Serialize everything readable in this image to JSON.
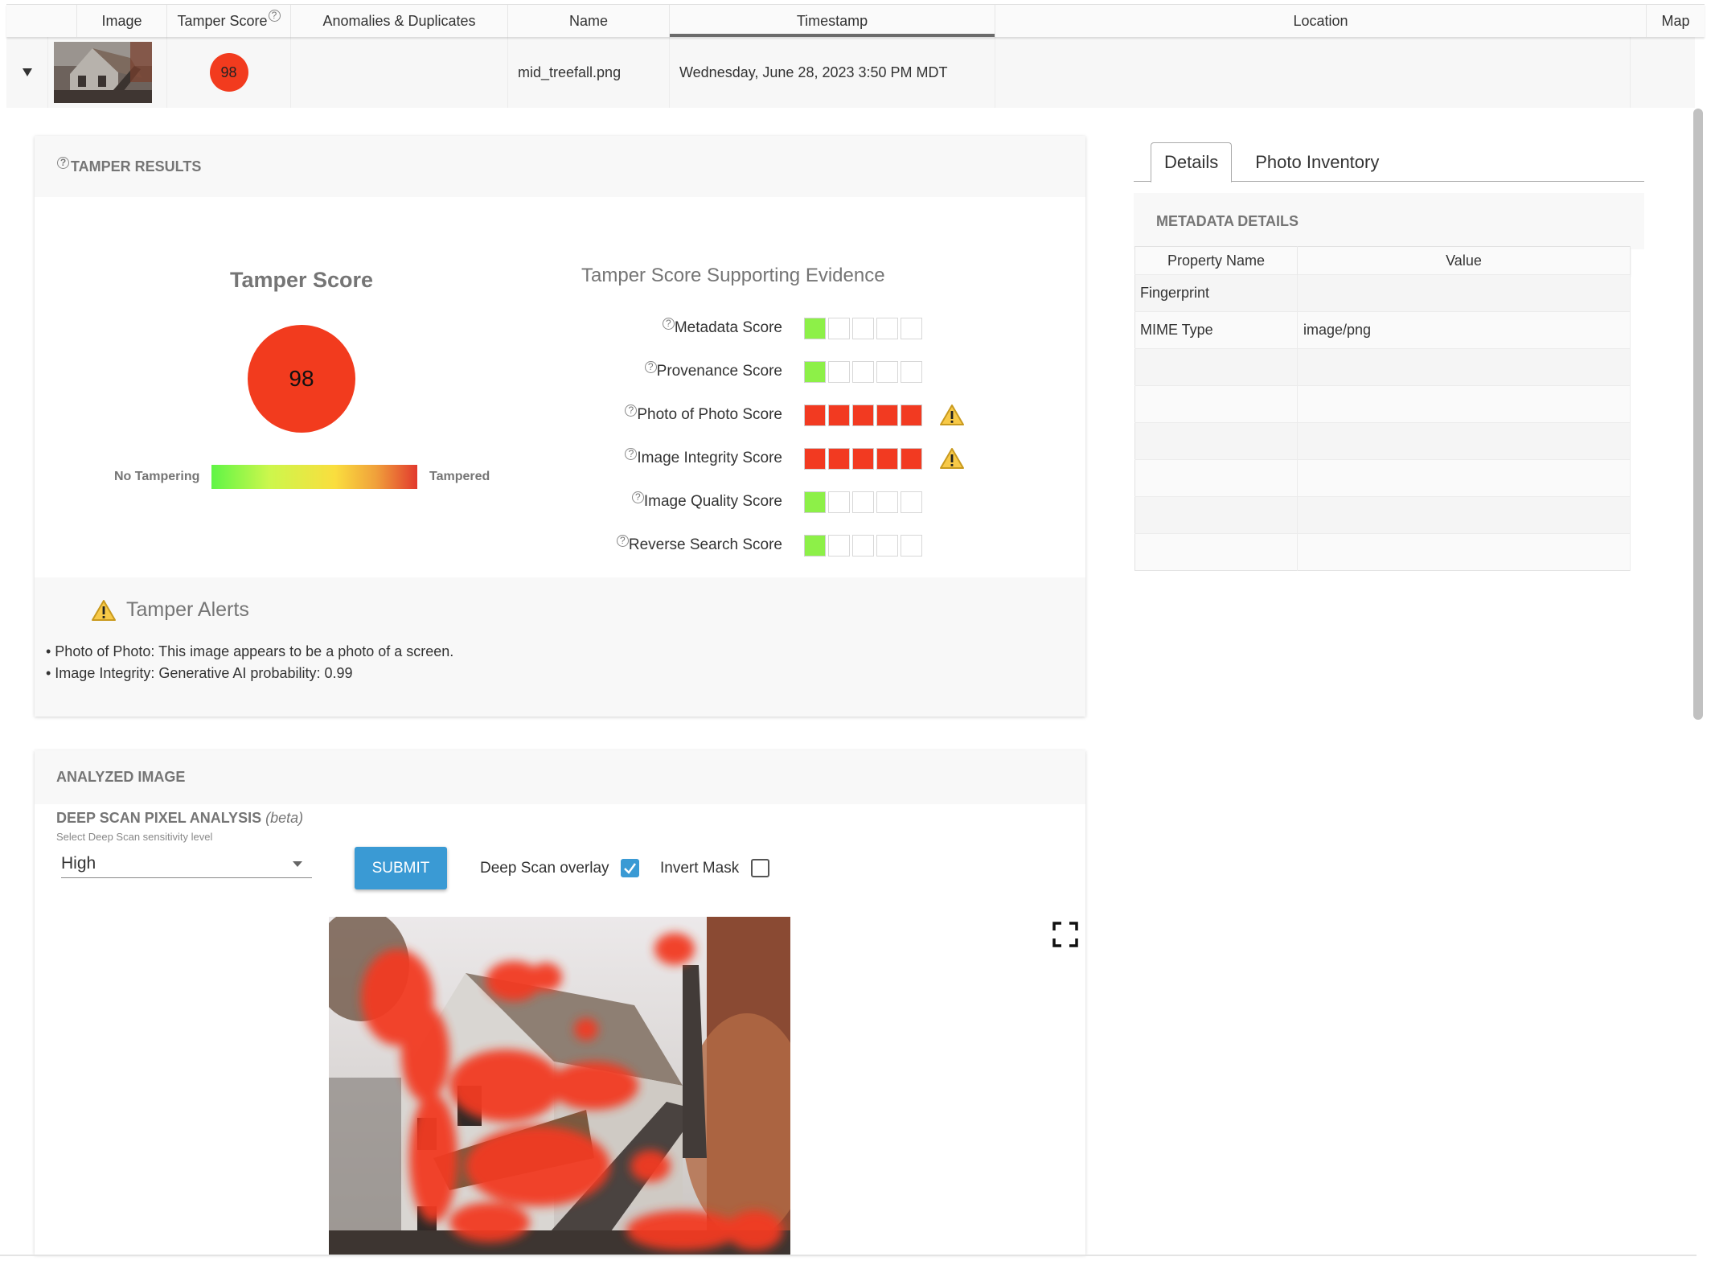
{
  "grid": {
    "columns": [
      {
        "key": "expand",
        "label": ""
      },
      {
        "key": "image",
        "label": "Image"
      },
      {
        "key": "tamper_score",
        "label": "Tamper Score",
        "help_icon": "question-circle-icon"
      },
      {
        "key": "anomalies",
        "label": "Anomalies & Duplicates"
      },
      {
        "key": "name",
        "label": "Name"
      },
      {
        "key": "timestamp",
        "label": "Timestamp",
        "sorted": true
      },
      {
        "key": "location",
        "label": "Location"
      },
      {
        "key": "map",
        "label": "Map"
      }
    ],
    "row": {
      "expanded": true,
      "tamper_score": "98",
      "anomalies": "",
      "name": "mid_treefall.png",
      "timestamp": "Wednesday, June 28, 2023 3:50 PM MDT",
      "location": "",
      "map": ""
    }
  },
  "tamper_results": {
    "section_title": "TAMPER RESULTS",
    "score_title": "Tamper Score",
    "score_value": "98",
    "score_color": "#f23b1e",
    "scale_low_label": "No Tampering",
    "scale_high_label": "Tampered",
    "evidence_title": "Tamper Score Supporting Evidence",
    "evidence": [
      {
        "label": "Metadata Score",
        "level": 1,
        "max": 5,
        "status": "ok",
        "warning": false
      },
      {
        "label": "Provenance Score",
        "level": 1,
        "max": 5,
        "status": "ok",
        "warning": false
      },
      {
        "label": "Photo of Photo Score",
        "level": 5,
        "max": 5,
        "status": "bad",
        "warning": true
      },
      {
        "label": "Image Integrity Score",
        "level": 5,
        "max": 5,
        "status": "bad",
        "warning": true
      },
      {
        "label": "Image Quality Score",
        "level": 1,
        "max": 5,
        "status": "ok",
        "warning": false
      },
      {
        "label": "Reverse Search Score",
        "level": 1,
        "max": 5,
        "status": "ok",
        "warning": false
      }
    ],
    "colors": {
      "ok": "#8df048",
      "bad": "#f23a21",
      "warning": "#f7c948"
    }
  },
  "tamper_alerts": {
    "title": "Tamper Alerts",
    "items": [
      "• Photo of Photo: This image appears to be a photo of a screen.",
      "• Image Integrity: Generative AI probability: 0.99"
    ]
  },
  "details_panel": {
    "tabs": [
      {
        "label": "Details",
        "active": true
      },
      {
        "label": "Photo Inventory",
        "active": false
      }
    ],
    "section_title": "METADATA DETAILS",
    "table": {
      "headers": [
        "Property Name",
        "Value"
      ],
      "rows": [
        [
          "Fingerprint",
          ""
        ],
        [
          "MIME Type",
          "image/png"
        ],
        [
          "",
          ""
        ],
        [
          "",
          ""
        ],
        [
          "",
          ""
        ],
        [
          "",
          ""
        ],
        [
          "",
          ""
        ],
        [
          "",
          ""
        ]
      ]
    }
  },
  "analyzed_image": {
    "section_title": "ANALYZED IMAGE",
    "deep_scan_title": "DEEP SCAN PIXEL ANALYSIS",
    "deep_scan_beta": "(beta)",
    "sensitivity_label": "Select Deep Scan sensitivity level",
    "sensitivity_value": "High",
    "submit_label": "SUBMIT",
    "overlay_label": "Deep Scan overlay",
    "overlay_checked": true,
    "invert_label": "Invert Mask",
    "invert_checked": false,
    "accent_color": "#3a9ad4"
  }
}
